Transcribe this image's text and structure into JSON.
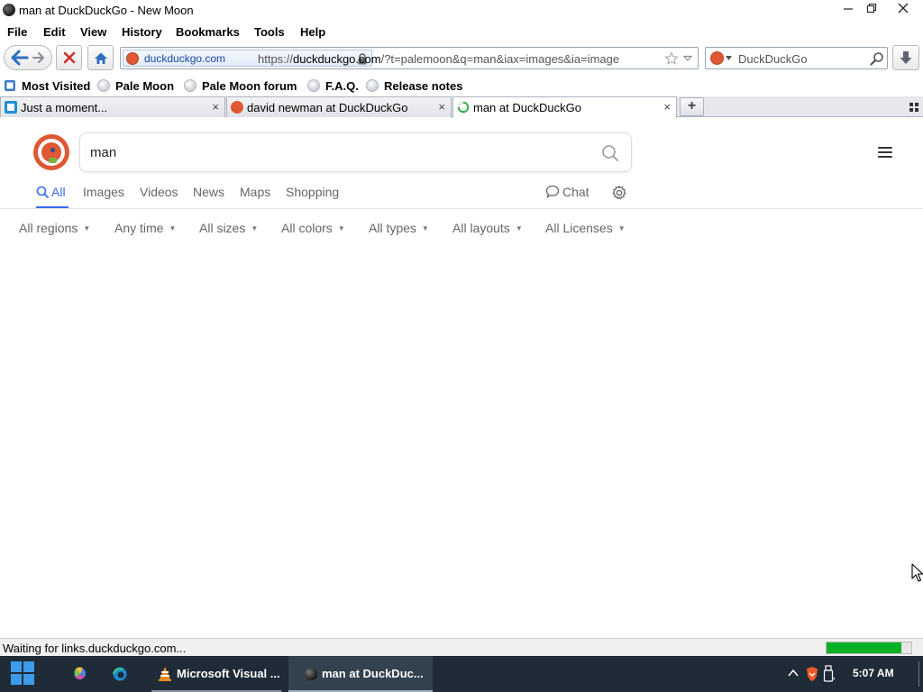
{
  "window": {
    "title": "man at DuckDuckGo - New Moon"
  },
  "menu": [
    "File",
    "Edit",
    "View",
    "History",
    "Bookmarks",
    "Tools",
    "Help"
  ],
  "navbar": {
    "identity_domain": "duckduckgo.com",
    "url_prefix": "https://",
    "url_host": "duckduckgo.com",
    "url_rest": "/?t=palemoon&q=man&iax=images&ia=image",
    "search_engine": "DuckDuckGo"
  },
  "bookmarks": [
    "Most Visited",
    "Pale Moon",
    "Pale Moon forum",
    "F.A.Q.",
    "Release notes"
  ],
  "tabs": [
    {
      "label": "Just a moment...",
      "close": "×"
    },
    {
      "label": "david newman at DuckDuckGo",
      "close": "×"
    },
    {
      "label": "man at DuckDuckGo",
      "close": "×"
    }
  ],
  "new_tab": "+",
  "page": {
    "query": "man",
    "nav_tabs": [
      "All",
      "Images",
      "Videos",
      "News",
      "Maps",
      "Shopping"
    ],
    "chat": "Chat",
    "filters": [
      "All regions",
      "Any time",
      "All sizes",
      "All colors",
      "All types",
      "All layouts",
      "All Licenses"
    ]
  },
  "status": {
    "text": "Waiting for links.duckduckgo.com...",
    "progress": 0.88
  },
  "taskbar": {
    "tasks": [
      "Microsoft Visual ...",
      "man at DuckDuc..."
    ],
    "clock": "5:07 AM"
  },
  "colors": {
    "ddg_orange": "#de5833",
    "ddg_blue": "#3969ef",
    "progress_green": "#06b025",
    "taskbar_bg": "#1f2b36"
  }
}
